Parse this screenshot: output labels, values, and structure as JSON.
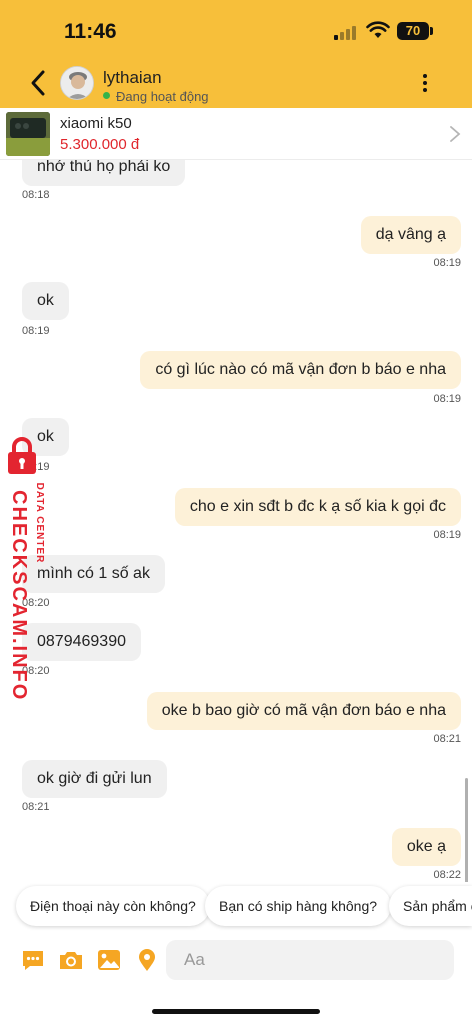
{
  "status_bar": {
    "time": "11:46",
    "battery": "70"
  },
  "header": {
    "contact_name": "lythaian",
    "online_status": "Đang hoạt động"
  },
  "product": {
    "name": "xiaomi k50",
    "price": "5.300.000 đ"
  },
  "messages": [
    {
      "dir": "in",
      "text": "nhớ thủ họ phải ko",
      "time": "08:18"
    },
    {
      "dir": "out",
      "text": "dạ vâng ạ",
      "time": "08:19"
    },
    {
      "dir": "in",
      "text": "ok",
      "time": "08:19"
    },
    {
      "dir": "out",
      "text": "có gì lúc nào có mã vận đơn b báo e nha",
      "time": "08:19"
    },
    {
      "dir": "in",
      "text": "ok",
      "time": "08:19"
    },
    {
      "dir": "out",
      "text": "cho e xin sđt b đc k ạ số kia k gọi đc",
      "time": "08:19"
    },
    {
      "dir": "in",
      "text": "mình có 1 số ak",
      "time": "08:20"
    },
    {
      "dir": "in",
      "text": "0879469390",
      "time": "08:20"
    },
    {
      "dir": "out",
      "text": "oke b bao giờ có mã vận đơn báo e nha",
      "time": "08:21"
    },
    {
      "dir": "in",
      "text": "ok giờ đi gửi lun",
      "time": "08:21"
    },
    {
      "dir": "out",
      "text": "oke ạ",
      "time": "08:22"
    }
  ],
  "watermark": {
    "main": "CHECKSCAM.INFO",
    "sub": "DATA CENTER"
  },
  "quick_replies": [
    "Điện thoại này còn không?",
    "Bạn có ship hàng không?",
    "Sản phẩm còn"
  ],
  "input": {
    "placeholder": "Aa"
  },
  "icons": [
    "back-arrow-icon",
    "more-vertical-icon",
    "chevron-right-icon",
    "chat-options-icon",
    "camera-icon",
    "image-icon",
    "location-pin-icon"
  ],
  "colors": {
    "header": "#f7bf3a",
    "incoming_bubble": "#f0f0f0",
    "outgoing_bubble": "#fdf1d8",
    "price": "#e0262c",
    "accent_icon": "#f5a623",
    "watermark": "#e32530"
  }
}
